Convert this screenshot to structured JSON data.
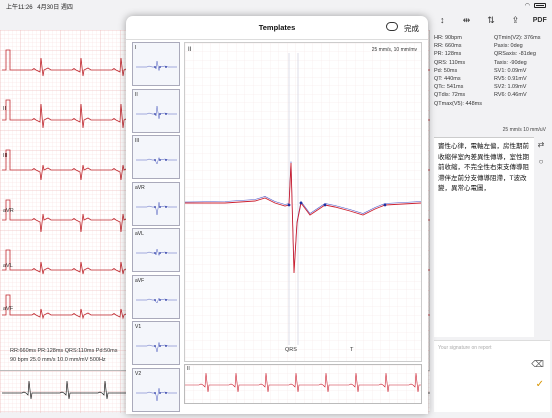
{
  "status": {
    "time": "上午11:26",
    "date": "4月30日 週四",
    "battery": ""
  },
  "background": {
    "leads": [
      "I",
      "II",
      "III",
      "aVR",
      "aVL",
      "aVF"
    ],
    "markers_top": [
      "0s",
      "N",
      "N",
      "1s",
      "N",
      "N",
      "N"
    ],
    "info_line1": "RR:660ms  PR:128ms  QRS:110ms  Pd:50ms",
    "info_line2": "90 bpm    25.0 mm/s  10.0 mm/mV   500Hz"
  },
  "toolbar": {
    "pdf_label": "PDF"
  },
  "measurements": [
    [
      "HR: 90bpm",
      "QTmin(V2): 376ms"
    ],
    [
      "RR: 660ms",
      "Paxis: 0deg"
    ],
    [
      "PR: 128ms",
      "QRSaxis: -81deg"
    ],
    [
      "QRS: 110ms",
      "Taxis: -90deg"
    ],
    [
      "Pd: 50ms",
      "SV1: 0.09mV"
    ],
    [
      "QT: 440ms",
      "RV5: 0.91mV"
    ],
    [
      "QTc: 541ms",
      "SV2: 1.09mV"
    ],
    [
      "QTdis: 72ms",
      "RV6: 0.46mV"
    ],
    [
      "QTmax(V5): 448ms",
      ""
    ]
  ],
  "scale_note": "25 mm/s  10 mm/uV",
  "interpretation": "竇性心律，電軸左偏，房性期前收縮伴室內差異性傳導，室性期前收縮，不完全性右束支傳導阻滯伴左前分支傳導阻滯，T波改變，異常心電圖，",
  "signature_placeholder": "Your signature on report",
  "modal": {
    "title": "Templates",
    "done_label": "完成",
    "lead_label": "II",
    "scale": "25 mm/s, 10 mm/mv",
    "qrs_marker": "QRS",
    "t_marker": "T",
    "thumbs": [
      "I",
      "II",
      "III",
      "aVR",
      "aVL",
      "aVF",
      "V1",
      "V2"
    ],
    "rhythm_label": "II"
  }
}
